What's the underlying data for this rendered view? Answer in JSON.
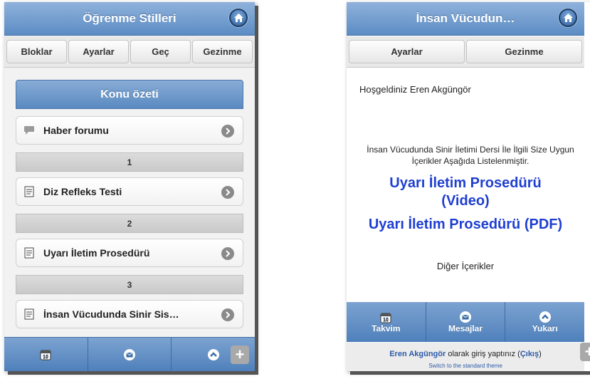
{
  "left": {
    "header_title": "Öğrenme Stilleri",
    "nav": [
      "Bloklar",
      "Ayarlar",
      "Geç",
      "Gezinme"
    ],
    "konu_title": "Konu özeti",
    "items": [
      {
        "label": "Haber forumu",
        "icon": "speech-bubble-icon"
      },
      {
        "label": "Diz Refleks Testi",
        "icon": "document-icon"
      },
      {
        "label": "Uyarı İletim Prosedürü",
        "icon": "document-icon"
      },
      {
        "label": "İnsan Vücudunda Sinir Sis…",
        "icon": "document-icon"
      }
    ],
    "sections": [
      "1",
      "2",
      "3"
    ],
    "footer_icons": [
      "calendar-icon",
      "mail-icon",
      "up-arrow-icon"
    ],
    "calendar_day": "10"
  },
  "right": {
    "header_title": "İnsan Vücudun…",
    "nav": [
      "Ayarlar",
      "Gezinme"
    ],
    "welcome": "Hoşgeldiniz Eren Akgüngör",
    "intro": "İnsan Vücudunda Sinir İletimi Dersi İle İlgili Size Uygun İçerikler Aşağıda Listelenmiştir.",
    "link1": "Uyarı İletim Prosedürü (Video)",
    "link2": "Uyarı İletim Prosedürü (PDF)",
    "other": "Diğer İçerikler",
    "footer": [
      "Takvim",
      "Mesajlar",
      "Yukarı"
    ],
    "calendar_day": "10",
    "login_name": "Eren Akgüngör",
    "login_text": " olarak giriş yaptınız (",
    "logout": "Çıkış",
    "login_close": ")",
    "switch_theme": "Switch to the standard theme"
  },
  "colors": {
    "accent": "#5c8cc4",
    "link": "#1f3fd1"
  }
}
